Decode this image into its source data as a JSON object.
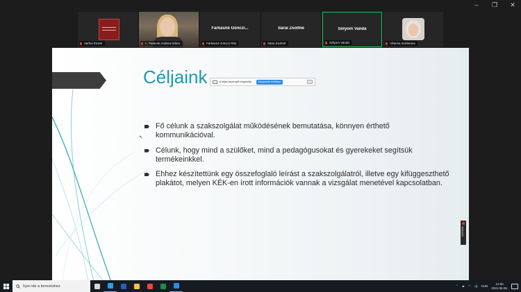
{
  "window": {
    "controls": [
      "–",
      "❐",
      "✕"
    ]
  },
  "participants": [
    {
      "label": "Varhei Eszter",
      "tile_type": "logo",
      "center_name": ""
    },
    {
      "label": "L. Patanok Andrea Diána",
      "tile_type": "video",
      "center_name": ""
    },
    {
      "label": "Farkasné Gönczi Rita",
      "tile_type": "name",
      "center_name": "Farkasné Gönczi..."
    },
    {
      "label": "Sárai Zsoltné",
      "tile_type": "name",
      "center_name": "Sárai Zsoltné"
    },
    {
      "label": "Sólyom Vanda",
      "tile_type": "name",
      "center_name": "Sólyom Vanda",
      "active": true
    },
    {
      "label": "Véterka Szebenes",
      "tile_type": "avatar",
      "center_name": ""
    }
  ],
  "slide": {
    "title": "Céljaink",
    "share_bar": {
      "text": "A teljes képernyőt megosztja",
      "button": "Megosztás leállítása"
    },
    "bullets": [
      "Fő célunk a szakszolgálat működésének bemutatása, könnyen érthető kommunikációval.",
      "Célunk, hogy mind a szülőket, mind a pedagógusokat és gyerekeket segítsük termékeinkkel.",
      "Ehhez készítettünk egy összefoglaló leírást a szakszolgálatról, illetve egy kifüggeszthető plakátot, melyen KÉK-en írott információk vannak a vizsgálat menetével kapcsolatban."
    ],
    "side_tag": "NORMÁL"
  },
  "taskbar": {
    "search_placeholder": "Írjon ide a kereséshez",
    "apps": [
      {
        "icon": "task-view-icon",
        "color": "#d7d7d7"
      },
      {
        "icon": "edge-icon",
        "color": "#2f9be5"
      },
      {
        "icon": "word-icon",
        "color": "#2b5cb8"
      },
      {
        "icon": "file-explorer-icon",
        "color": "#f3c14b"
      },
      {
        "icon": "chrome-icon",
        "color": "#e9493c"
      },
      {
        "icon": "excel-icon",
        "color": "#1e8a4d"
      },
      {
        "icon": "zoom-icon",
        "color": "#2d8ce6"
      }
    ],
    "language": "HUN",
    "time": "12:55",
    "date": "2021.06.06."
  },
  "colors": {
    "title": "#1a9bb6",
    "active_border": "#23c552",
    "taskbar": "#161b22"
  }
}
